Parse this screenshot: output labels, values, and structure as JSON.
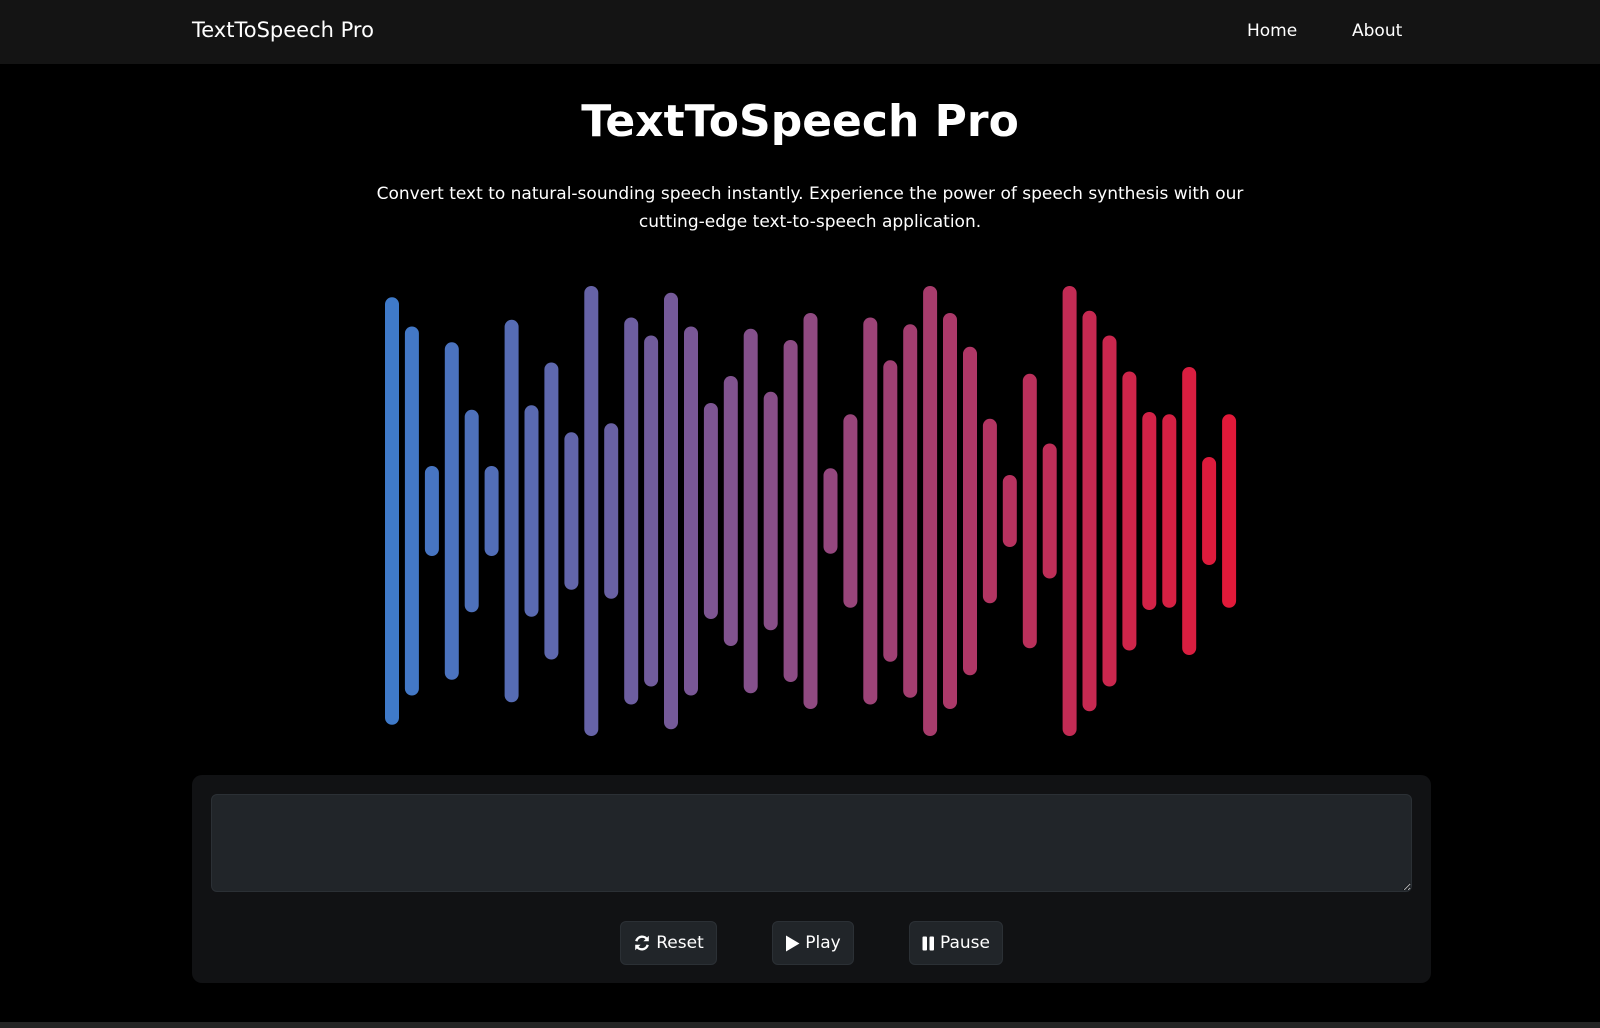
{
  "nav": {
    "brand": "TextToSpeech Pro",
    "links": [
      "Home",
      "About"
    ]
  },
  "hero": {
    "title": "TextToSpeech Pro",
    "description": "Convert text to natural-sounding speech instantly. Experience the power of speech synthesis with our cutting-edge text-to-speech application."
  },
  "waveform": {
    "colors": {
      "start": "#3f7ac9",
      "end": "#e11939"
    },
    "bar_levels": [
      0.95,
      0.82,
      0.2,
      0.75,
      0.45,
      0.2,
      0.85,
      0.47,
      0.66,
      0.35,
      1.0,
      0.39,
      0.86,
      0.78,
      0.97,
      0.82,
      0.48,
      0.6,
      0.81,
      0.53,
      0.76,
      0.88,
      0.19,
      0.43,
      0.86,
      0.67,
      0.83,
      1.0,
      0.88,
      0.73,
      0.41,
      0.16,
      0.61,
      0.3,
      1.0,
      0.89,
      0.78,
      0.62,
      0.44,
      0.43,
      0.64,
      0.24,
      0.43
    ]
  },
  "editor": {
    "text_value": "",
    "placeholder": ""
  },
  "controls": {
    "reset_label": "Reset",
    "play_label": "Play",
    "pause_label": "Pause"
  },
  "icons": {
    "reset": "sync-arrows-icon",
    "play": "play-triangle-icon",
    "pause": "pause-bars-icon"
  }
}
